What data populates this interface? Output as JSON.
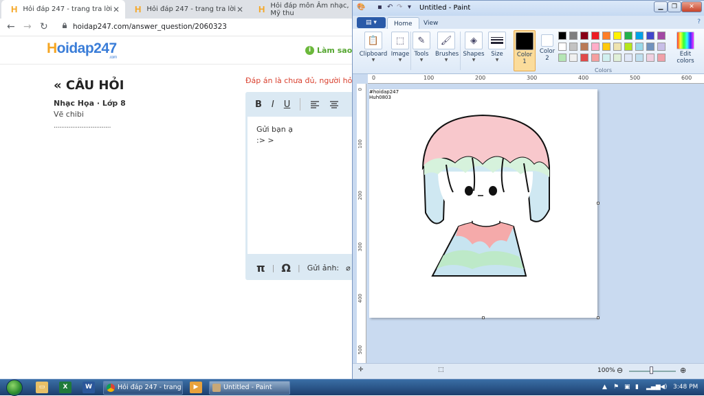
{
  "browser": {
    "tabs": [
      {
        "title": "Hỏi đáp 247 - trang tra lời",
        "active": true
      },
      {
        "title": "Hỏi đáp 247 - trang tra lời",
        "active": false
      },
      {
        "title": "Hỏi đáp môn Âm nhạc, Mỹ thu",
        "active": false
      }
    ],
    "tab_close": "✕",
    "url": "hoidap247.com/answer_question/2060323"
  },
  "site": {
    "logo_h": "H",
    "logo_rest": "oidap247",
    "logo_com": ".com",
    "how_link": "Làm sao đ",
    "question_title": "« CÂU HỎI",
    "subject": "Nhạc Họa · Lớp 8",
    "question_body": "Vẽ chibi",
    "dots": "...............................",
    "warning": "Đáp án là chưa đủ, người hỏi",
    "editor": {
      "bold": "B",
      "italic": "I",
      "underline": "U",
      "content_line1": "Gửi bạn ạ",
      "content_line2": ":> >",
      "pi": "π",
      "omega": "Ω",
      "attach_label": "Gửi ảnh:"
    }
  },
  "paint": {
    "title": "Untitled - Paint",
    "file_menu": "▤ ▾",
    "tabs": [
      "Home",
      "View"
    ],
    "groups": [
      "Clipboard",
      "Image",
      "Tools",
      "Brushes",
      "Shapes",
      "Size"
    ],
    "color1_label": "Color 1",
    "color2_label": "Color 2",
    "edit_colors_label": "Edit colors",
    "colors_label": "Colors",
    "palette_row1": [
      "#000000",
      "#7f7f7f",
      "#880015",
      "#ed1c24",
      "#ff7f27",
      "#fff200",
      "#22b14c",
      "#00a2e8",
      "#3f48cc",
      "#a349a4"
    ],
    "palette_row2": [
      "#ffffff",
      "#c3c3c3",
      "#b97a57",
      "#ffaec9",
      "#ffc90e",
      "#efe4b0",
      "#b5e61d",
      "#99d9ea",
      "#7092be",
      "#c8bfe7"
    ],
    "palette_row3": [
      "#b5e6b5",
      "#f0f0f0",
      "#e04a4a",
      "#f5a0a0",
      "#d0f0f0",
      "#e0f0d8",
      "#e0e8f8",
      "#c0e0f0",
      "#f0d0e0",
      "#f0a0a8"
    ],
    "hruler_ticks": [
      "0",
      "100",
      "200",
      "300",
      "400",
      "500",
      "600"
    ],
    "vruler_ticks": [
      "0",
      "100",
      "200",
      "300",
      "400",
      "500"
    ],
    "canvas_caption1": "#hoidap247",
    "canvas_caption2": "Huh0803",
    "zoom": "100%"
  },
  "taskbar": {
    "chrome_btn": "Hỏi đáp 247 - trang t...",
    "paint_btn": "Untitled - Paint",
    "time": "3:48 PM"
  },
  "colors": {
    "hair_pink": "#f8c8cc",
    "hair_mint": "#d6f2dc",
    "hair_blue": "#cfe8f2",
    "shirt_pink": "#f5aaaa",
    "shirt_mint": "#bde9c8",
    "shirt_blue": "#c7e4f0"
  }
}
